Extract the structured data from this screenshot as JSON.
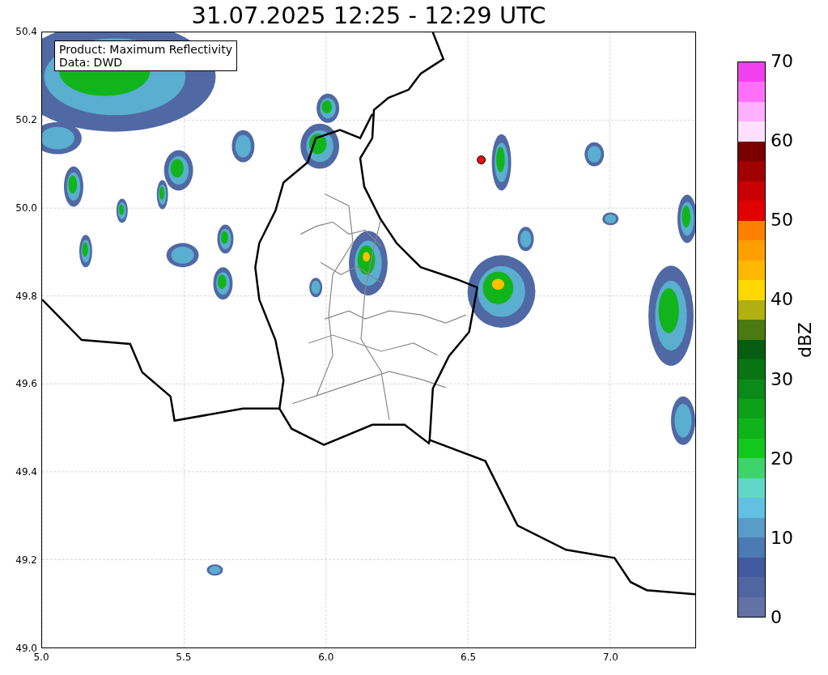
{
  "title": "31.07.2025 12:25 - 12:29 UTC",
  "info_box": [
    "Product: Maximum Reflectivity",
    "Data: DWD"
  ],
  "y_ticks": [
    "50.4",
    "50.2",
    "50.0",
    "49.8",
    "49.6",
    "49.4",
    "49.2",
    "49.0"
  ],
  "x_ticks": [
    "5.0",
    "5.5",
    "6.0",
    "6.5",
    "7.0"
  ],
  "colorbar": {
    "label": "dBZ",
    "ticks": [
      "70",
      "60",
      "50",
      "40",
      "30",
      "20",
      "10",
      "0"
    ],
    "segments": [
      {
        "color": "#f040f0"
      },
      {
        "color": "#ff70f8"
      },
      {
        "color": "#ffb0ff"
      },
      {
        "color": "#ffe0ff"
      },
      {
        "color": "#7a0000"
      },
      {
        "color": "#a00000"
      },
      {
        "color": "#c80000"
      },
      {
        "color": "#e00000"
      },
      {
        "color": "#ff8000"
      },
      {
        "color": "#ffa000"
      },
      {
        "color": "#ffb800"
      },
      {
        "color": "#ffd800"
      },
      {
        "color": "#b0b010"
      },
      {
        "color": "#4b7a10"
      },
      {
        "color": "#075e10"
      },
      {
        "color": "#097414"
      },
      {
        "color": "#0a8a18"
      },
      {
        "color": "#0ea01a"
      },
      {
        "color": "#10b41a"
      },
      {
        "color": "#12c81c"
      },
      {
        "color": "#3ed46c"
      },
      {
        "color": "#60d8c8"
      },
      {
        "color": "#62c0e0"
      },
      {
        "color": "#5a9cc8"
      },
      {
        "color": "#4c7ab2"
      },
      {
        "color": "#425a9e"
      },
      {
        "color": "#5066a0"
      },
      {
        "color": "#6272a4"
      }
    ]
  }
}
